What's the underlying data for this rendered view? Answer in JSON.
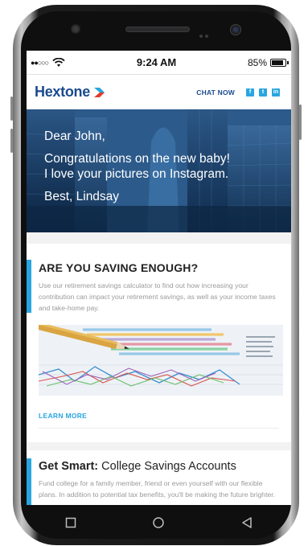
{
  "status_bar": {
    "signal": "●●○○○",
    "time": "9:24 AM",
    "battery_text": "85%",
    "battery_level": 0.85
  },
  "header": {
    "logo": "Hextone",
    "chat_now": "CHAT NOW",
    "social": [
      "f",
      "t",
      "in"
    ]
  },
  "hero": {
    "greeting": "Dear John,",
    "message_line1": "Congratulations on the new baby!",
    "message_line2": "I love your pictures on Instagram.",
    "signoff": "Best, Lindsay"
  },
  "card1": {
    "title": "ARE YOU SAVING ENOUGH?",
    "body": "Use our retirement savings calculator to find out how increasing your contribution can impact your retirement savings, as well as your income taxes and take-home pay.",
    "link": "LEARN MORE"
  },
  "card2": {
    "title_bold": "Get Smart:",
    "title_rest": " College Savings Accounts",
    "body": "Fund college for a family member, friend or even yourself with our flexible plans. In addition to potential tax benefits, you'll be making the future brighter."
  },
  "colors": {
    "brand_blue": "#1a4a8e",
    "accent_cyan": "#29a6e0",
    "logo_red": "#e23b2e"
  },
  "icons": {
    "nav": [
      "square-icon",
      "circle-icon",
      "triangle-back-icon"
    ]
  }
}
